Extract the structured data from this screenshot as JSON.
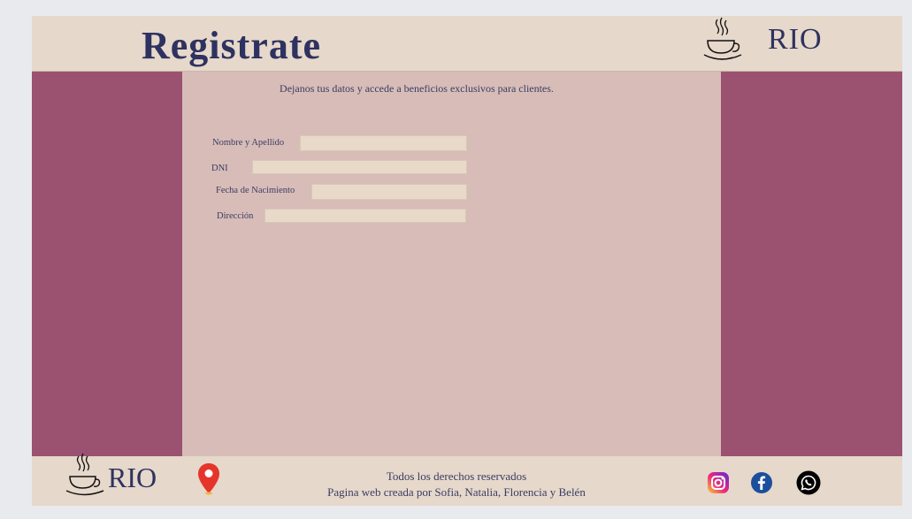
{
  "header": {
    "title": "Registrate",
    "brand": "RIO"
  },
  "intro": "Dejanos tus datos y accede a beneficios exclusivos para clientes.",
  "form": {
    "fields": [
      {
        "label": "Nombre y Apellido",
        "value": ""
      },
      {
        "label": "DNI",
        "value": ""
      },
      {
        "label": "Fecha de Nacimiento",
        "value": ""
      },
      {
        "label": "Dirección",
        "value": ""
      }
    ]
  },
  "footer": {
    "brand": "RIO",
    "rights": "Todos los derechos reservados",
    "credits": "Pagina web creada por Sofia, Natalia, Florencia y Belén",
    "icons": [
      "location-pin-icon",
      "instagram-icon",
      "facebook-icon",
      "whatsapp-icon"
    ]
  },
  "colors": {
    "beige": "#e6d8ca",
    "plum": "#9b5270",
    "rose": "#d8bcb8",
    "navy": "#2e3260"
  }
}
